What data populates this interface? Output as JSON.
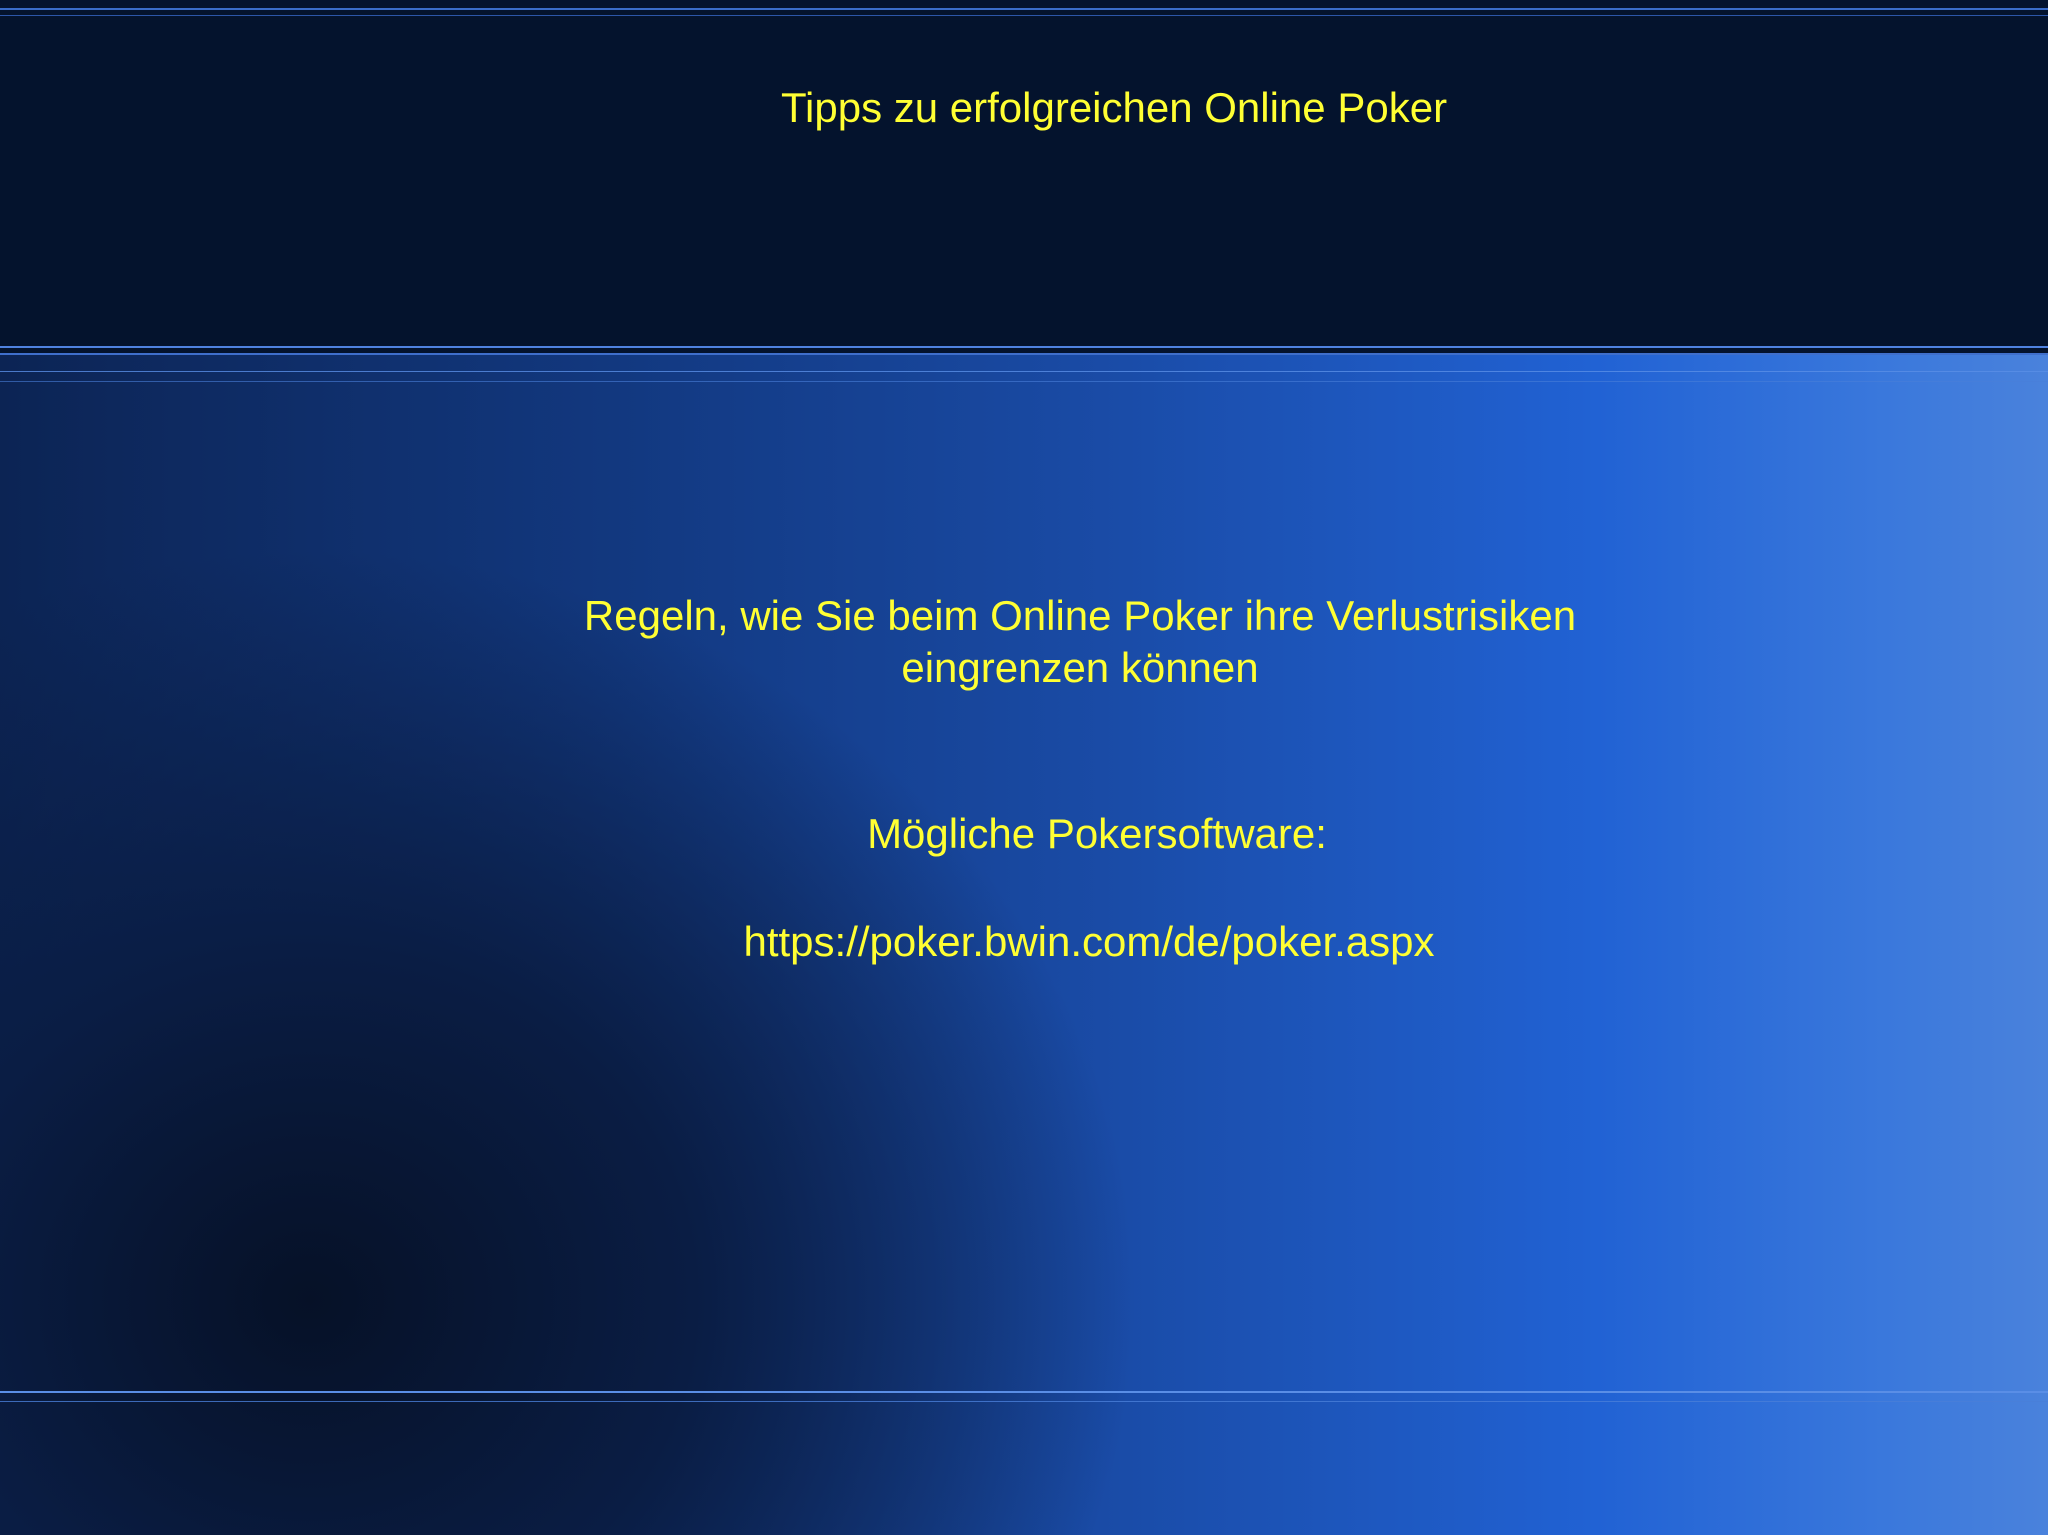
{
  "slide": {
    "title": "Tipps zu erfolgreichen Online Poker",
    "body": {
      "rules_line1": "Regeln, wie Sie beim Online Poker ihre Verlustrisiken",
      "rules_line2": "eingrenzen können",
      "software_label": "Mögliche Pokersoftware:",
      "software_url": "https://poker.bwin.com/de/poker.aspx"
    },
    "colors": {
      "text": "#ffff33",
      "header_background": "#04132d",
      "accent_line": "#4f82e0"
    }
  }
}
